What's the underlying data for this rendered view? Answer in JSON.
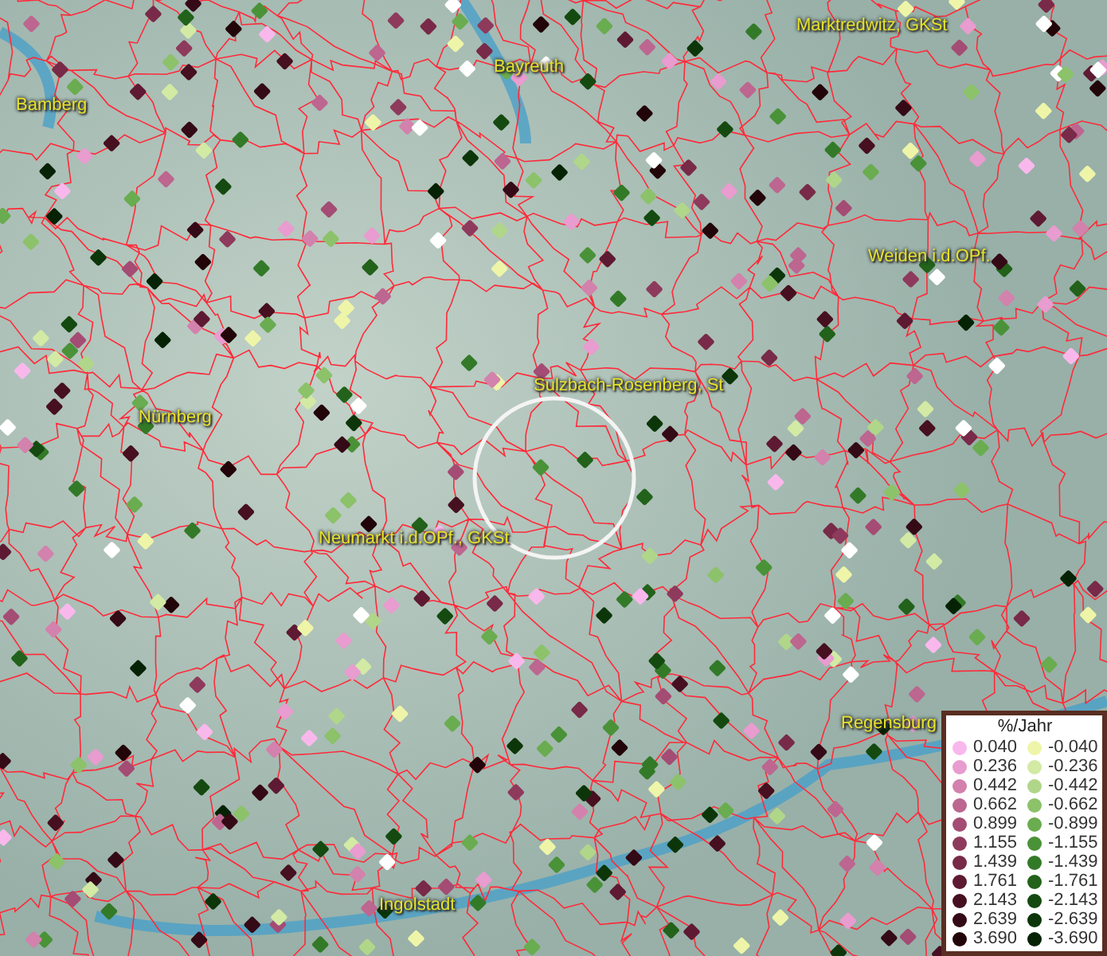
{
  "map": {
    "places": [
      {
        "name": "Marktredwitz, GKSt"
      },
      {
        "name": "Bayreuth"
      },
      {
        "name": "Bamberg"
      },
      {
        "name": "Weiden i.d.OPf."
      },
      {
        "name": "Nürnberg"
      },
      {
        "name": "Sulzbach-Rosenberg, St"
      },
      {
        "name": "Neumarkt i.d.OPf., GKSt"
      },
      {
        "name": "Regensburg"
      },
      {
        "name": "Ingolstadt"
      }
    ]
  },
  "legend": {
    "title": "%/Jahr",
    "rows": [
      {
        "left": {
          "label": "0.040",
          "color": "#f9b8ec"
        },
        "right": {
          "label": "-0.040",
          "color": "#eef5a8"
        }
      },
      {
        "left": {
          "label": "0.236",
          "color": "#e89ccf"
        },
        "right": {
          "label": "-0.236",
          "color": "#d2eaa4"
        }
      },
      {
        "left": {
          "label": "0.442",
          "color": "#d282ac"
        },
        "right": {
          "label": "-0.442",
          "color": "#b0d68a"
        }
      },
      {
        "left": {
          "label": "0.662",
          "color": "#bc6690"
        },
        "right": {
          "label": "-0.662",
          "color": "#8cc26a"
        }
      },
      {
        "left": {
          "label": "0.899",
          "color": "#a44c74"
        },
        "right": {
          "label": "-0.899",
          "color": "#6aac50"
        }
      },
      {
        "left": {
          "label": "1.155",
          "color": "#8e3a5c"
        },
        "right": {
          "label": "-1.155",
          "color": "#4a9238"
        }
      },
      {
        "left": {
          "label": "1.439",
          "color": "#782a48"
        },
        "right": {
          "label": "-1.439",
          "color": "#337a28"
        }
      },
      {
        "left": {
          "label": "1.761",
          "color": "#5e1a32"
        },
        "right": {
          "label": "-1.761",
          "color": "#22621a"
        }
      },
      {
        "left": {
          "label": "2.143",
          "color": "#461020"
        },
        "right": {
          "label": "-2.143",
          "color": "#144a10"
        }
      },
      {
        "left": {
          "label": "2.639",
          "color": "#340a16"
        },
        "right": {
          "label": "-2.639",
          "color": "#0c360a"
        }
      },
      {
        "left": {
          "label": "3.690",
          "color": "#220508"
        },
        "right": {
          "label": "-3.690",
          "color": "#062204"
        }
      }
    ]
  }
}
